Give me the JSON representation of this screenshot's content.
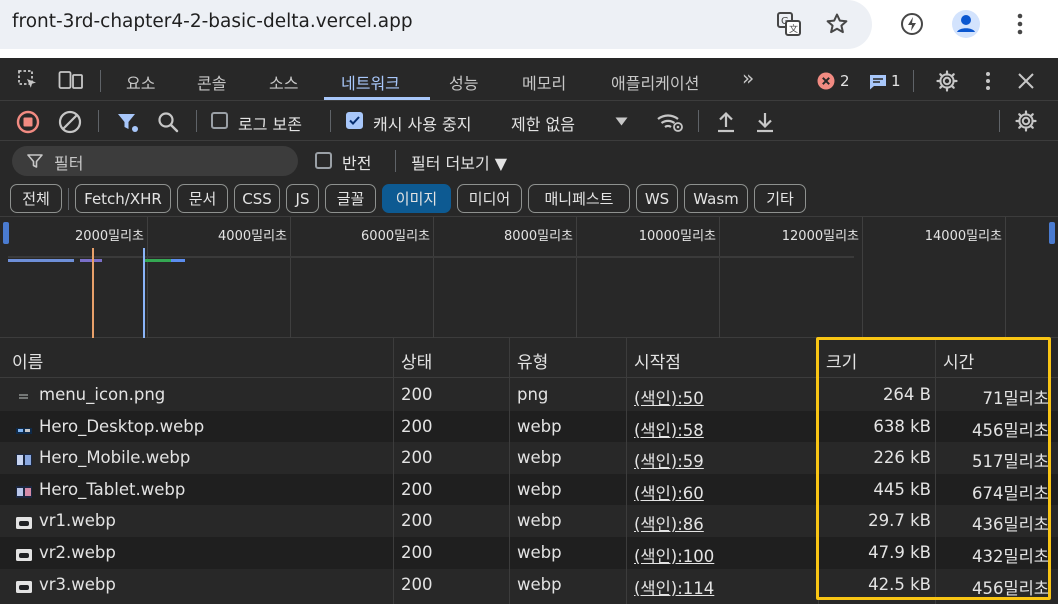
{
  "browser": {
    "url": "front-3rd-chapter4-2-basic-delta.vercel.app"
  },
  "devtools": {
    "tabs": [
      "요소",
      "콘솔",
      "소스",
      "네트워크",
      "성능",
      "메모리",
      "애플리케이션"
    ],
    "active_tab": "네트워크",
    "more_tabs": "»",
    "error_count": "2",
    "message_count": "1",
    "colors": {
      "accent": "#a8c7fa",
      "error": "#f28b82",
      "highlight": "#f9c514",
      "selected_chip": "#0d5a92"
    }
  },
  "toolbar": {
    "preserve_log": "로그 보존",
    "preserve_log_checked": false,
    "disable_cache": "캐시 사용 중지",
    "disable_cache_checked": true,
    "throttling": "제한 없음"
  },
  "filter": {
    "placeholder": "필터",
    "invert": "반전",
    "invert_checked": false,
    "more_filters": "필터 더보기 ▼"
  },
  "type_chips": [
    "전체",
    "Fetch/XHR",
    "문서",
    "CSS",
    "JS",
    "글꼴",
    "이미지",
    "미디어",
    "매니페스트",
    "WS",
    "Wasm",
    "기타"
  ],
  "selected_chip": "이미지",
  "overview": {
    "ticks": [
      "2000밀리초",
      "4000밀리초",
      "6000밀리초",
      "8000밀리초",
      "10000밀리초",
      "12000밀리초",
      "14000밀리초"
    ]
  },
  "table": {
    "columns": [
      "이름",
      "상태",
      "유형",
      "시작점",
      "크기",
      "시간"
    ],
    "rows": [
      {
        "icon": "generic-file-icon",
        "name": "menu_icon.png",
        "status": "200",
        "type": "png",
        "initiator": "(색인):50",
        "size": "264 B",
        "time": "71밀리초"
      },
      {
        "icon": "image-thumbnail-icon",
        "name": "Hero_Desktop.webp",
        "status": "200",
        "type": "webp",
        "initiator": "(색인):58",
        "size": "638 kB",
        "time": "456밀리초"
      },
      {
        "icon": "image-thumbnail-icon",
        "name": "Hero_Mobile.webp",
        "status": "200",
        "type": "webp",
        "initiator": "(색인):59",
        "size": "226 kB",
        "time": "517밀리초"
      },
      {
        "icon": "image-thumbnail-icon",
        "name": "Hero_Tablet.webp",
        "status": "200",
        "type": "webp",
        "initiator": "(색인):60",
        "size": "445 kB",
        "time": "674밀리초"
      },
      {
        "icon": "image-thumbnail-icon",
        "name": "vr1.webp",
        "status": "200",
        "type": "webp",
        "initiator": "(색인):86",
        "size": "29.7 kB",
        "time": "436밀리초"
      },
      {
        "icon": "image-thumbnail-icon",
        "name": "vr2.webp",
        "status": "200",
        "type": "webp",
        "initiator": "(색인):100",
        "size": "47.9 kB",
        "time": "432밀리초"
      },
      {
        "icon": "image-thumbnail-icon",
        "name": "vr3.webp",
        "status": "200",
        "type": "webp",
        "initiator": "(색인):114",
        "size": "42.5 kB",
        "time": "456밀리초"
      }
    ]
  }
}
